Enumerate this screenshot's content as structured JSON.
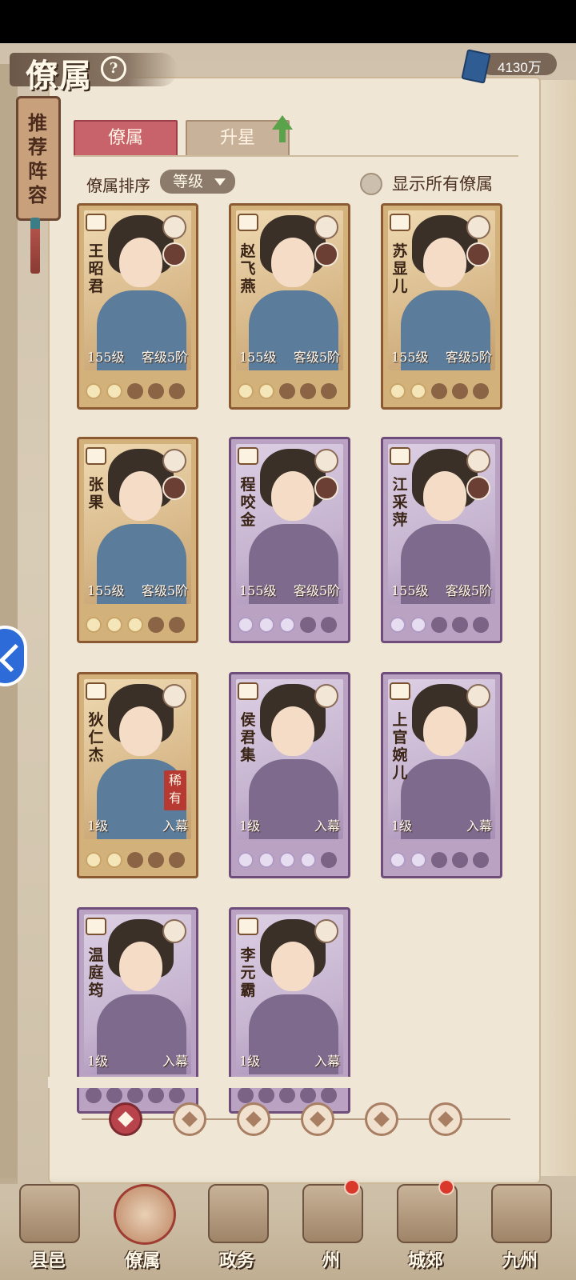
{
  "header": {
    "title": "僚属",
    "help": "?",
    "currency_amount": "4130万"
  },
  "side_tag": {
    "text": "推荐阵容"
  },
  "tabs": [
    {
      "label": "僚属"
    },
    {
      "label": "升星"
    }
  ],
  "sort": {
    "label": "僚属排序",
    "value": "等级"
  },
  "toggle": {
    "label": "显示所有僚属"
  },
  "cards": [
    {
      "name": "王昭君",
      "level": "155级",
      "grade": "客级5阶",
      "stars_on": 2,
      "rarity": "gold",
      "type_icon": "yin-yang-icon"
    },
    {
      "name": "赵飞燕",
      "level": "155级",
      "grade": "客级5阶",
      "stars_on": 2,
      "rarity": "gold",
      "type_icon": "sword-icon"
    },
    {
      "name": "苏显儿",
      "level": "155级",
      "grade": "客级5阶",
      "stars_on": 2,
      "rarity": "gold",
      "type_icon": "sword-icon"
    },
    {
      "name": "张果",
      "level": "155级",
      "grade": "客级5阶",
      "stars_on": 3,
      "rarity": "gold",
      "type_icon": "yin-yang-icon"
    },
    {
      "name": "程咬金",
      "level": "155级",
      "grade": "客级5阶",
      "stars_on": 3,
      "rarity": "purple",
      "type_icon": "shield-icon"
    },
    {
      "name": "江采萍",
      "level": "155级",
      "grade": "客级5阶",
      "stars_on": 2,
      "rarity": "purple",
      "type_icon": "hat-icon"
    },
    {
      "name": "狄仁杰",
      "level": "1级",
      "grade": "入幕",
      "stars_on": 2,
      "rarity": "gold",
      "type_icon": "yin-yang-icon",
      "rare": "稀有"
    },
    {
      "name": "侯君集",
      "level": "1级",
      "grade": "入幕",
      "stars_on": 4,
      "rarity": "purple",
      "type_icon": "sword-icon"
    },
    {
      "name": "上官婉儿",
      "level": "1级",
      "grade": "入幕",
      "stars_on": 2,
      "rarity": "purple",
      "type_icon": "hat-icon"
    },
    {
      "name": "温庭筠",
      "level": "1级",
      "grade": "入幕",
      "stars_on": 0,
      "rarity": "purple",
      "type_icon": "yin-yang-icon"
    },
    {
      "name": "李元霸",
      "level": "1级",
      "grade": "入幕",
      "stars_on": 0,
      "rarity": "purple",
      "type_icon": "shield-icon"
    }
  ],
  "filters": [
    {
      "icon": "all-filter-icon"
    },
    {
      "icon": "moon-filter-icon"
    },
    {
      "icon": "cat-filter-icon"
    },
    {
      "icon": "fan-filter-icon"
    },
    {
      "icon": "lion-filter-icon"
    },
    {
      "icon": "flower-filter-icon"
    }
  ],
  "nav": [
    {
      "label": "县邑",
      "badge": false
    },
    {
      "label": "僚属",
      "badge": false
    },
    {
      "label": "政务",
      "badge": false
    },
    {
      "label": "州",
      "badge": true
    },
    {
      "label": "城郊",
      "badge": true
    },
    {
      "label": "九州",
      "badge": false
    }
  ],
  "colors": {
    "active_tab": "#c8636b",
    "rare_badge": "#b63a32",
    "nav_badge": "#d8392b"
  }
}
